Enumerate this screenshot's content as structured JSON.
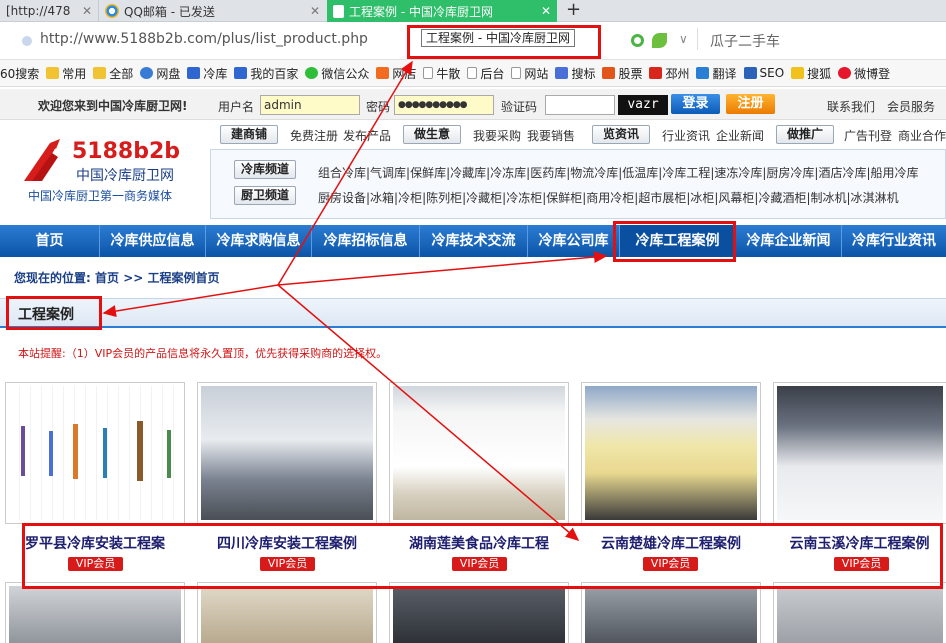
{
  "tabs": [
    {
      "label": "[http://478"
    },
    {
      "label": "QQ邮箱 - 已发送"
    },
    {
      "label": "工程案例 - 中国冷库厨卫网"
    }
  ],
  "newtab_label": "+",
  "address": {
    "url": "http://www.5188b2b.com/plus/list_product.php",
    "tooltip": "工程案例 - 中国冷库厨卫网",
    "search_hint": "瓜子二手车"
  },
  "bookmarks": [
    "60搜索",
    "常用",
    "全部",
    "网盘",
    "冷库",
    "我的百家",
    "微信公众",
    "网店",
    "牛散",
    "后台",
    "网站",
    "搜标",
    "股票",
    "邳州",
    "翻译",
    "SEO",
    "搜狐",
    "微博登"
  ],
  "login": {
    "welcome": "欢迎您来到中国冷库厨卫网!",
    "user_label": "用户名",
    "user_value": "admin",
    "pwd_label": "密码",
    "pwd_value": "●●●●●●●●●●",
    "captcha_label": "验证码",
    "captcha_code": "vazr",
    "login_btn": "登录",
    "register_btn": "注册",
    "contact": "联系我们",
    "member": "会员服务"
  },
  "logo": {
    "brand": "5188b2b",
    "name": "中国冷库厨卫网",
    "slogan": "中国冷库厨卫第一商务媒体"
  },
  "topbar": {
    "btn1": "建商铺",
    "t1": "免费注册",
    "t2": "发布产品",
    "btn2": "做生意",
    "t3": "我要采购",
    "t4": "我要销售",
    "btn3": "览资讯",
    "t5": "行业资讯",
    "t6": "企业新闻",
    "btn4": "做推广",
    "t7": "广告刊登",
    "t8": "商业合作"
  },
  "channels": {
    "cold_label": "冷库频道",
    "cold_items": "组合冷库|气调库|保鲜库|冷藏库|冷冻库|医药库|物流冷库|低温库|冷库工程|速冻冷库|厨房冷库|酒店冷库|船用冷库",
    "kitchen_label": "厨卫频道",
    "kitchen_items": "厨房设备|冰箱|冷柜|陈列柜|冷藏柜|冷冻柜|保鲜柜|商用冷柜|超市展柜|冰柜|风幕柜|冷藏酒柜|制冰机|冰淇淋机"
  },
  "nav": [
    "首页",
    "冷库供应信息",
    "冷库求购信息",
    "冷库招标信息",
    "冷库技术交流",
    "冷库公司库",
    "冷库工程案例",
    "冷库企业新闻",
    "冷库行业资讯"
  ],
  "breadcrumb": {
    "prefix": "您现在的位置:",
    "home": "首页",
    "sep": ">>",
    "current": "工程案例首页"
  },
  "section_title": "工程案例",
  "notice": "本站提醒:（1）VIP会员的产品信息将永久置顶，优先获得采购商的选择权。",
  "products": [
    {
      "title": "罗平县冷库安装工程案",
      "badge": "VIP会员"
    },
    {
      "title": "四川冷库安装工程案例",
      "badge": "VIP会员"
    },
    {
      "title": "湖南莲美食品冷库工程",
      "badge": "VIP会员"
    },
    {
      "title": "云南楚雄冷库工程案例",
      "badge": "VIP会员"
    },
    {
      "title": "云南玉溪冷库工程案例",
      "badge": "VIP会员"
    }
  ],
  "colors": {
    "nav_active": "#0a4fa0",
    "highlight_red": "#e41010",
    "accent_green": "#2fbe6a"
  }
}
